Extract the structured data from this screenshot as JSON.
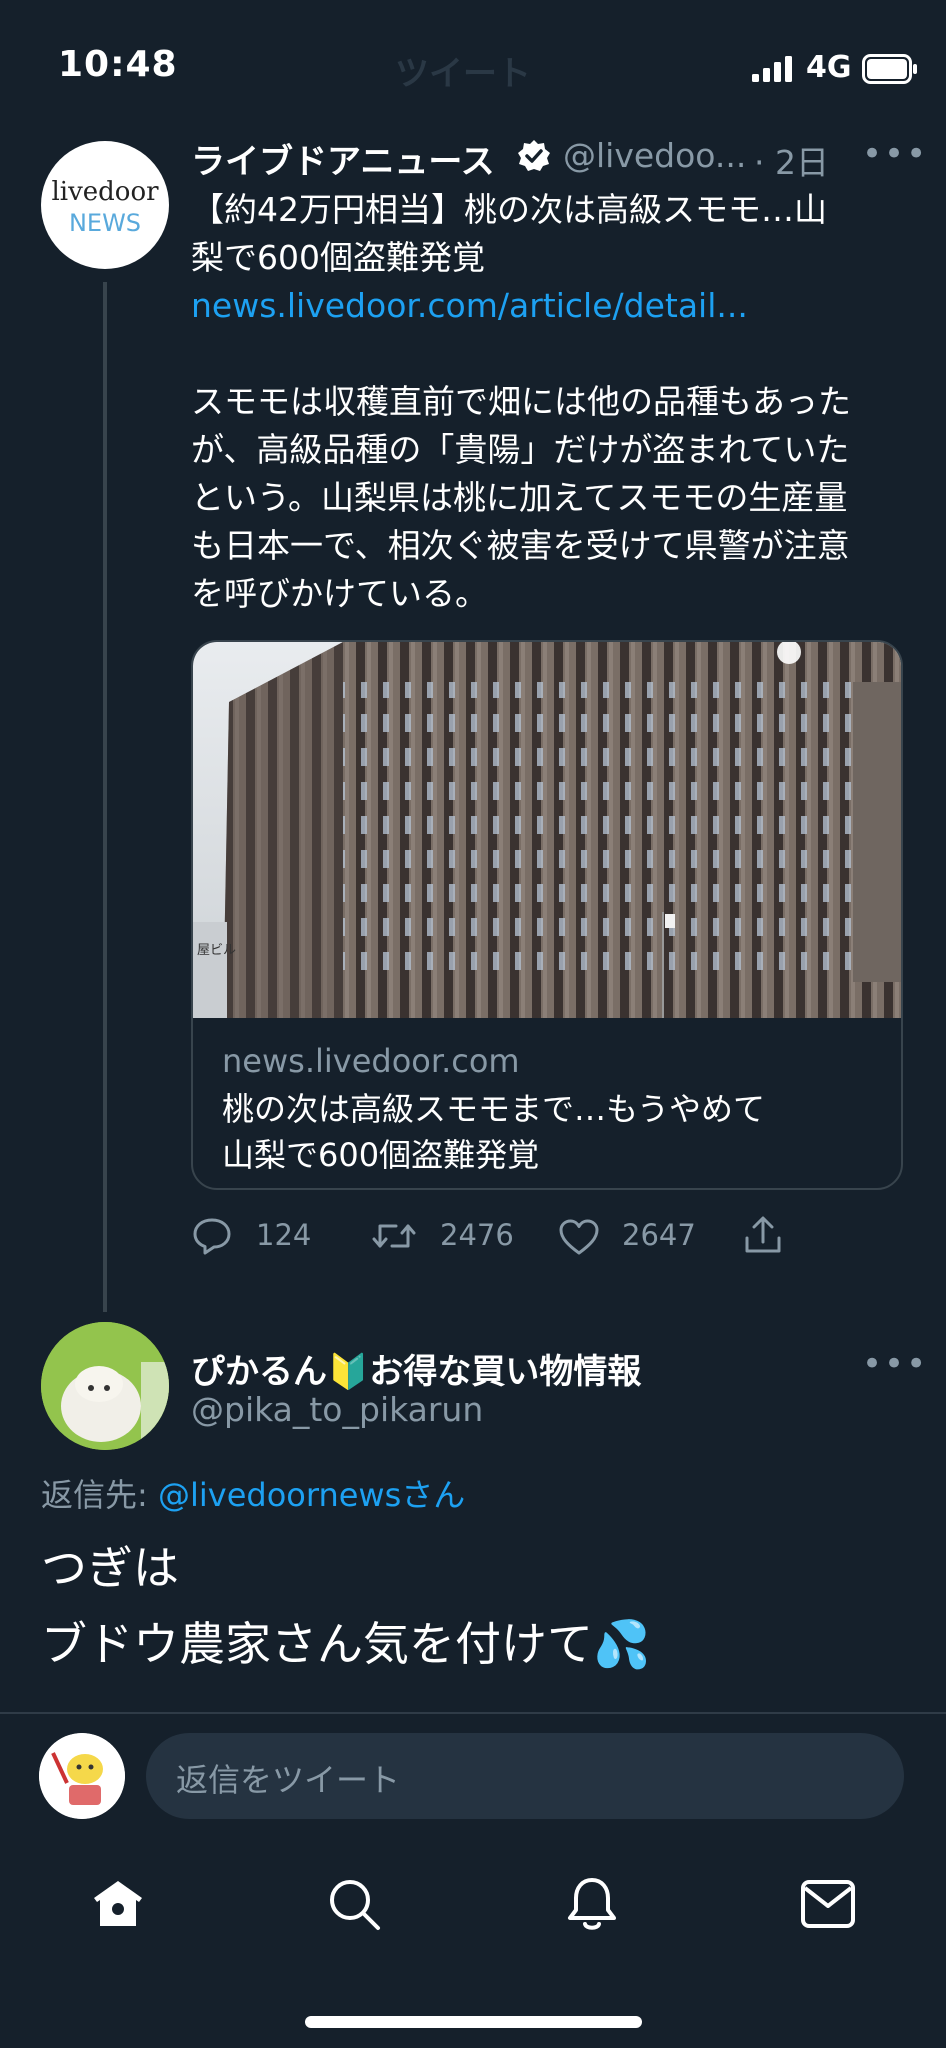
{
  "status_bar": {
    "time": "10:48",
    "network": "4G"
  },
  "header": {
    "faint_title": "ツイート"
  },
  "tweet": {
    "avatar_text_top": "livedoor",
    "avatar_text_bottom": "NEWS",
    "author_name": "ライブドアニュース",
    "handle": "@livedoo...",
    "time": "· 2日",
    "text_line1": "【約42万円相当】桃の次は高級スモモ…山",
    "text_line2": "梨で600個盗難発覚",
    "link": "news.livedoor.com/article/detail...",
    "body_lines": [
      "スモモは収穫直前で畑には他の品種もあった",
      "が、高級品種の「貴陽」だけが盗まれていた",
      "という。山梨県は桃に加えてスモモの生産量",
      "も日本一で、相次ぐ被害を受けて県警が注意",
      "を呼びかけている。"
    ],
    "card": {
      "domain": "news.livedoor.com",
      "title_line1": "桃の次は高級スモモまで…もうやめて",
      "title_line2": "山梨で600個盗難発覚",
      "image_sign_text": "屋ビル"
    },
    "actions": {
      "replies": "124",
      "retweets": "2476",
      "likes": "2647"
    }
  },
  "reply": {
    "author_name": "ぴかるん🔰お得な買い物情報",
    "handle": "@pika_to_pikarun",
    "reply_to_label": "返信先: ",
    "reply_to_mention": "@livedoornewsさん",
    "text_line1": "つぎは",
    "text_line2": "ブドウ農家さん気を付けて💦"
  },
  "composer": {
    "placeholder": "返信をツイート"
  },
  "nav": [
    "home-icon",
    "search-icon",
    "notifications-icon",
    "messages-icon"
  ],
  "colors": {
    "background": "#15202b",
    "accent": "#1da1f2",
    "muted": "#8899a6",
    "border": "#38444d"
  }
}
